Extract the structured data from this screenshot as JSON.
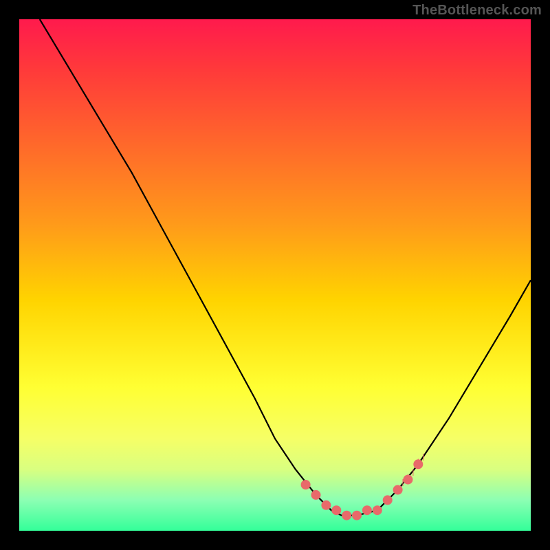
{
  "watermark": "TheBottleneck.com",
  "chart_data": {
    "type": "line",
    "title": "",
    "xlabel": "",
    "ylabel": "",
    "xlim": [
      0,
      100
    ],
    "ylim": [
      0,
      100
    ],
    "grid": false,
    "legend": false,
    "series": [
      {
        "name": "curve",
        "x": [
          4,
          10,
          16,
          22,
          28,
          34,
          40,
          46,
          50,
          54,
          58,
          61,
          63,
          66,
          70,
          74,
          78,
          84,
          90,
          96,
          100
        ],
        "y": [
          100,
          90,
          80,
          70,
          59,
          48,
          37,
          26,
          18,
          12,
          7,
          4,
          3,
          3,
          4,
          8,
          13,
          22,
          32,
          42,
          49
        ]
      }
    ],
    "markers": {
      "name": "highlight-points",
      "x": [
        56,
        58,
        60,
        62,
        64,
        66,
        68,
        70,
        72,
        74,
        76,
        78
      ],
      "y": [
        9,
        7,
        5,
        4,
        3,
        3,
        4,
        4,
        6,
        8,
        10,
        13
      ]
    },
    "accent_ticks": {
      "x": [
        75,
        76,
        77,
        78,
        79
      ],
      "y": [
        9,
        10,
        11,
        13,
        14
      ]
    }
  },
  "colors": {
    "curve": "#000000",
    "marker": "#e86a6a",
    "background_top": "#ff1a4d",
    "background_bottom": "#33ff99",
    "frame": "#000000"
  }
}
